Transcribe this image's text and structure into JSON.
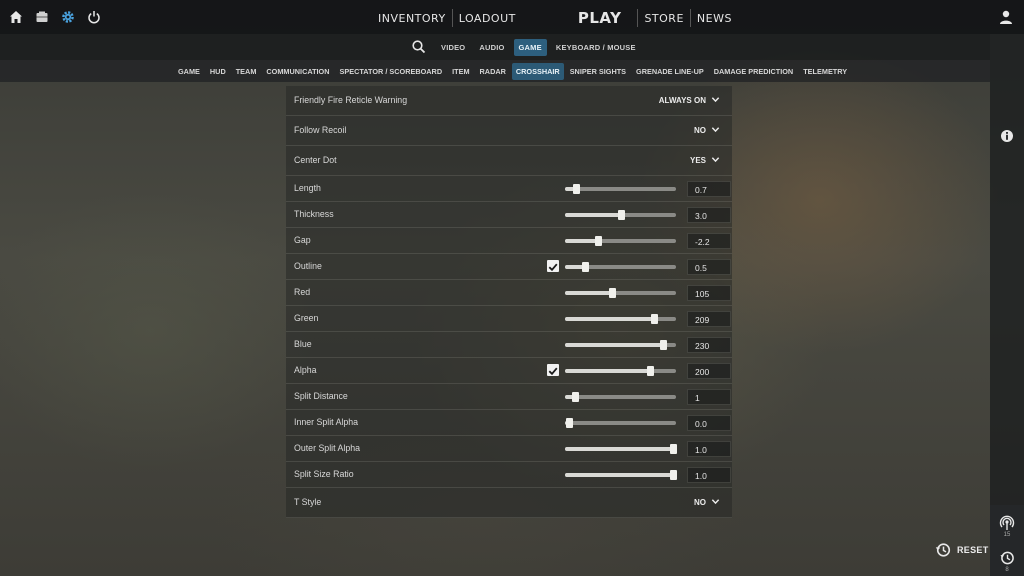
{
  "nav": {
    "main": [
      "Inventory",
      "Loadout",
      "Play",
      "Store",
      "News"
    ],
    "tabs": [
      {
        "label": "Video",
        "active": false
      },
      {
        "label": "Audio",
        "active": false
      },
      {
        "label": "Game",
        "active": true
      },
      {
        "label": "Keyboard / Mouse",
        "active": false
      }
    ],
    "categories": [
      {
        "label": "Game",
        "active": false
      },
      {
        "label": "HUD",
        "active": false
      },
      {
        "label": "Team",
        "active": false
      },
      {
        "label": "Communication",
        "active": false
      },
      {
        "label": "Spectator / Scoreboard",
        "active": false
      },
      {
        "label": "Item",
        "active": false
      },
      {
        "label": "Radar",
        "active": false
      },
      {
        "label": "Crosshair",
        "active": true
      },
      {
        "label": "Sniper Sights",
        "active": false
      },
      {
        "label": "Grenade Line-up",
        "active": false
      },
      {
        "label": "Damage Prediction",
        "active": false
      },
      {
        "label": "Telemetry",
        "active": false
      }
    ]
  },
  "settings": {
    "dropdowns": [
      {
        "label": "Friendly Fire Reticle Warning",
        "value": "ALWAYS ON"
      },
      {
        "label": "Follow Recoil",
        "value": "NO"
      },
      {
        "label": "Center Dot",
        "value": "YES"
      }
    ],
    "sliders": [
      {
        "label": "Length",
        "value": "0.7",
        "level": 0.1,
        "checkbox": false
      },
      {
        "label": "Thickness",
        "value": "3.0",
        "level": 0.5,
        "checkbox": false
      },
      {
        "label": "Gap",
        "value": "-2.2",
        "level": 0.3,
        "checkbox": false
      },
      {
        "label": "Outline",
        "value": "0.5",
        "level": 0.18,
        "checkbox": true
      },
      {
        "label": "Red",
        "value": "105",
        "level": 0.42,
        "checkbox": false
      },
      {
        "label": "Green",
        "value": "209",
        "level": 0.8,
        "checkbox": false
      },
      {
        "label": "Blue",
        "value": "230",
        "level": 0.88,
        "checkbox": false
      },
      {
        "label": "Alpha",
        "value": "200",
        "level": 0.77,
        "checkbox": true
      },
      {
        "label": "Split Distance",
        "value": "1",
        "level": 0.09,
        "checkbox": false
      },
      {
        "label": "Inner Split Alpha",
        "value": "0.0",
        "level": 0.04,
        "checkbox": false
      },
      {
        "label": "Outer Split Alpha",
        "value": "1.0",
        "level": 0.97,
        "checkbox": false
      },
      {
        "label": "Split Size Ratio",
        "value": "1.0",
        "level": 0.97,
        "checkbox": false
      }
    ],
    "t_style": {
      "label": "T Style",
      "value": "NO"
    }
  },
  "sidebar": {
    "stream_count": "15",
    "history_count": "8"
  },
  "reset_label": "RESET",
  "colors": {
    "accent": "#2d5f7e",
    "panel": "#262826"
  },
  "icons": {
    "top_left": [
      "home-icon",
      "case-icon",
      "gear-icon",
      "power-icon"
    ],
    "right": [
      "profile-icon",
      "info-icon",
      "broadcast-icon",
      "history-icon"
    ]
  }
}
